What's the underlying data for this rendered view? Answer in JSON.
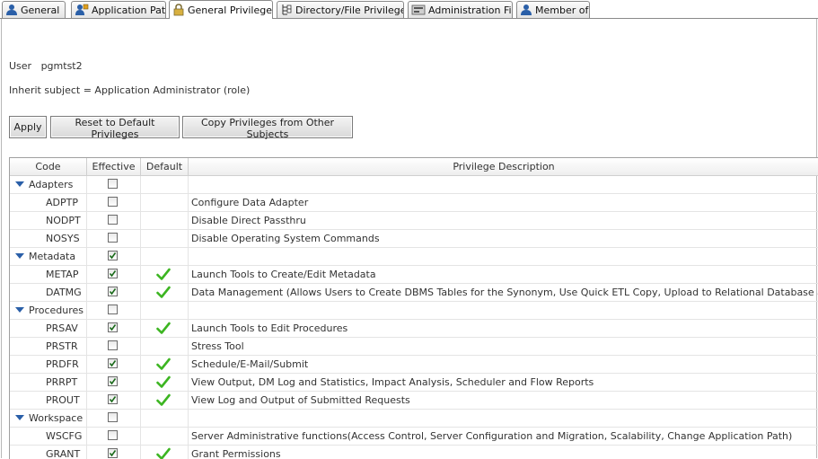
{
  "tabs": [
    {
      "label": "General",
      "icon": "user-icon",
      "active": false
    },
    {
      "label": "Application Path",
      "icon": "application-path-icon",
      "active": false
    },
    {
      "label": "General Privileges",
      "icon": "lock-icon",
      "active": true
    },
    {
      "label": "Directory/File Privileges",
      "icon": "directory-tree-icon",
      "active": false
    },
    {
      "label": "Administration File",
      "icon": "admin-file-icon",
      "active": false
    },
    {
      "label": "Member of",
      "icon": "user-icon",
      "active": false
    }
  ],
  "info": {
    "user_label": "User",
    "user_value": "pgmtst2",
    "inherit_text": "Inherit subject = Application Administrator (role)"
  },
  "buttons": {
    "apply": "Apply",
    "reset": "Reset to Default Privileges",
    "copy": "Copy Privileges from Other Subjects"
  },
  "table": {
    "headers": {
      "code": "Code",
      "effective": "Effective",
      "default": "Default",
      "description": "Privilege Description"
    },
    "rows": [
      {
        "type": "group",
        "code": "Adapters",
        "effective": false,
        "default": false,
        "description": ""
      },
      {
        "type": "item",
        "code": "ADPTP",
        "effective": false,
        "default": false,
        "description": "Configure Data Adapter"
      },
      {
        "type": "item",
        "code": "NODPT",
        "effective": false,
        "default": false,
        "description": "Disable Direct Passthru"
      },
      {
        "type": "item",
        "code": "NOSYS",
        "effective": false,
        "default": false,
        "description": "Disable Operating System Commands"
      },
      {
        "type": "group",
        "code": "Metadata",
        "effective": true,
        "default": false,
        "description": ""
      },
      {
        "type": "item",
        "code": "METAP",
        "effective": true,
        "default": true,
        "description": "Launch Tools to Create/Edit Metadata"
      },
      {
        "type": "item",
        "code": "DATMG",
        "effective": true,
        "default": true,
        "description": "Data Management (Allows Users to Create DBMS Tables for the Synonym, Use Quick ETL Copy, Upload to Relational Database and Re-load Data)"
      },
      {
        "type": "group",
        "code": "Procedures",
        "effective": false,
        "default": false,
        "description": ""
      },
      {
        "type": "item",
        "code": "PRSAV",
        "effective": true,
        "default": true,
        "description": "Launch Tools to Edit Procedures"
      },
      {
        "type": "item",
        "code": "PRSTR",
        "effective": false,
        "default": false,
        "description": "Stress Tool"
      },
      {
        "type": "item",
        "code": "PRDFR",
        "effective": true,
        "default": true,
        "description": "Schedule/E-Mail/Submit"
      },
      {
        "type": "item",
        "code": "PRRPT",
        "effective": true,
        "default": true,
        "description": "View Output, DM Log and Statistics, Impact Analysis, Scheduler and Flow Reports"
      },
      {
        "type": "item",
        "code": "PROUT",
        "effective": true,
        "default": true,
        "description": "View Log and Output of Submitted Requests"
      },
      {
        "type": "group",
        "code": "Workspace",
        "effective": false,
        "default": false,
        "description": ""
      },
      {
        "type": "item",
        "code": "WSCFG",
        "effective": false,
        "default": false,
        "description": "Server Administrative functions(Access Control, Server Configuration and Migration, Scalability, Change Application Path)"
      },
      {
        "type": "item",
        "code": "GRANT",
        "effective": true,
        "default": true,
        "description": "Grant Permissions"
      }
    ]
  },
  "colors": {
    "checkmark": "#3cb521",
    "expand_arrow": "#2a5fa8"
  }
}
